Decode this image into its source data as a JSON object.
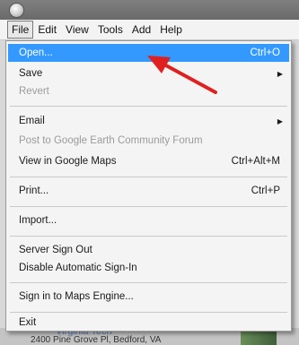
{
  "menubar": {
    "items": [
      "File",
      "Edit",
      "View",
      "Tools",
      "Add",
      "Help"
    ]
  },
  "file_menu": {
    "open": {
      "label": "Open...",
      "shortcut": "Ctrl+O"
    },
    "save": {
      "label": "Save"
    },
    "revert": {
      "label": "Revert"
    },
    "email": {
      "label": "Email"
    },
    "post_forum": {
      "label": "Post to Google Earth Community Forum"
    },
    "view_maps": {
      "label": "View in Google Maps",
      "shortcut": "Ctrl+Alt+M"
    },
    "print": {
      "label": "Print...",
      "shortcut": "Ctrl+P"
    },
    "import": {
      "label": "Import..."
    },
    "server_sign_out": {
      "label": "Server Sign Out"
    },
    "disable_auto_signin": {
      "label": "Disable Automatic Sign-In"
    },
    "sign_in_maps_engine": {
      "label": "Sign in to Maps Engine..."
    },
    "exit": {
      "label": "Exit"
    }
  },
  "colors": {
    "highlight": "#3399ff",
    "annotation_arrow": "#e02020"
  },
  "background": {
    "partial_text_1": "Virginia Tech",
    "partial_text_2": "2400 Pine Grove Pl, Bedford, VA"
  }
}
